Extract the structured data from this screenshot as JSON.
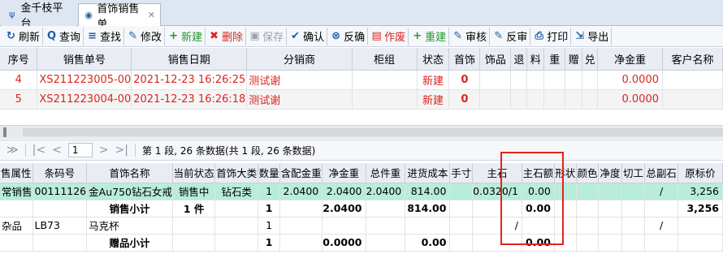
{
  "tabs": [
    {
      "label": "金千枝平台",
      "icon": "brand-icon"
    },
    {
      "label": "首饰销售单",
      "icon": "sales-doc-icon"
    }
  ],
  "toolbar": [
    {
      "label": "刷新",
      "icon": "refresh-icon",
      "glyph": "↻",
      "color": "blue"
    },
    {
      "label": "查询",
      "icon": "search-icon",
      "glyph": "Q",
      "color": "blue"
    },
    {
      "label": "查找",
      "icon": "find-icon",
      "glyph": "≡",
      "color": "blue"
    },
    {
      "label": "修改",
      "icon": "edit-icon",
      "glyph": "✎",
      "color": "blue"
    },
    {
      "label": "新建",
      "icon": "add-icon",
      "glyph": "+",
      "color": "green"
    },
    {
      "label": "删除",
      "icon": "delete-icon",
      "glyph": "✖",
      "color": "red"
    },
    {
      "label": "保存",
      "icon": "save-icon",
      "glyph": "▣",
      "color": "gray"
    },
    {
      "label": "确认",
      "icon": "confirm-icon",
      "glyph": "✔",
      "color": "blue"
    },
    {
      "label": "反确",
      "icon": "unconfirm-icon",
      "glyph": "⊗",
      "color": "blue"
    },
    {
      "label": "作废",
      "icon": "void-icon",
      "glyph": "▤",
      "color": "red"
    },
    {
      "label": "重建",
      "icon": "rebuild-icon",
      "glyph": "+",
      "color": "green"
    },
    {
      "label": "审核",
      "icon": "audit-icon",
      "glyph": "✎",
      "color": "blue"
    },
    {
      "label": "反审",
      "icon": "unaudit-icon",
      "glyph": "✎",
      "color": "blue"
    },
    {
      "label": "打印",
      "icon": "print-icon",
      "glyph": "⎙",
      "color": "blue"
    },
    {
      "label": "导出",
      "icon": "export-icon",
      "glyph": "⇲",
      "color": "blue"
    }
  ],
  "grid1": {
    "headers": [
      "序号",
      "销售单号",
      "销售日期",
      "分销商",
      "柜组",
      "状态",
      "首饰",
      "饰品",
      "退",
      "料",
      "重",
      "赠",
      "兑",
      "净金重",
      "客户名称"
    ],
    "rows": [
      [
        "4",
        "XS211223005-00",
        "2021-12-23 16:26:25",
        "测试谢",
        "",
        "新建",
        "0",
        "",
        "",
        "",
        "",
        "",
        "",
        "0.0000",
        ""
      ],
      [
        "5",
        "XS211223004-00",
        "2021-12-23 16:26:18",
        "测试谢",
        "",
        "新建",
        "0",
        "",
        "",
        "",
        "",
        "",
        "",
        "0.0000",
        ""
      ]
    ]
  },
  "pager": {
    "page": "1",
    "info": "第 1 段, 26 条数据(共 1 段, 26 条数据)"
  },
  "grid2": {
    "headers": [
      "售属性",
      "条码号",
      "首饰名称",
      "当前状态",
      "首饰大类",
      "数量",
      "含配金重",
      "净金重",
      "总件重",
      "进货成本",
      "手寸",
      "主石",
      "主石额",
      "形状",
      "颜色",
      "净度",
      "切工",
      "总副石",
      "原标价"
    ],
    "rows": [
      [
        "常销售",
        "00111126",
        "金Au750钻石女戒",
        "销售中",
        "钻石类",
        "1",
        "2.0400",
        "2.0400",
        "2.0400",
        "814.00",
        "",
        "0.0320/1",
        "0.00",
        "",
        "",
        "",
        "",
        "/",
        "3,256"
      ],
      [
        "",
        "",
        "销售小计",
        "1 件",
        "",
        "1",
        "",
        "2.0400",
        "",
        "814.00",
        "",
        "",
        "0.00",
        "",
        "",
        "",
        "",
        "",
        "3,256"
      ],
      [
        "杂品",
        "LB73",
        "马克杯",
        "",
        "",
        "1",
        "",
        "",
        "",
        "",
        "",
        "/",
        "",
        "",
        "",
        "",
        "",
        "/",
        ""
      ],
      [
        "",
        "",
        "赠品小计",
        "",
        "",
        "1",
        "",
        "0.0000",
        "",
        "0.00",
        "",
        "",
        "0.00",
        "",
        "",
        "",
        "",
        "",
        ""
      ]
    ]
  }
}
